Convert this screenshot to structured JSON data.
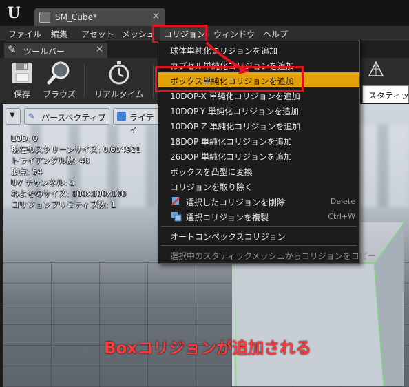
{
  "window": {
    "app_logo": "U",
    "asset_tab": {
      "label": "SM_Cube*",
      "close": "×"
    }
  },
  "menubar": {
    "items": [
      "ファイル",
      "編集",
      "アセット",
      "メッシュ",
      "コリジョン",
      "ウィンドウ",
      "ヘルプ"
    ],
    "active": "コリジョン"
  },
  "toolbar": {
    "tab_label": "ツールバー",
    "tab_close": "×",
    "buttons": [
      "保存",
      "ブラウズ",
      "リアルタイム"
    ]
  },
  "viewport": {
    "menu_arrow": "▼",
    "perspective_label": "パースペクティブ",
    "lit_label": "ライティ",
    "stats": [
      "LOD: 0",
      "現在のスクリーンサイズ: 0.604921",
      "トライアングル数: 48",
      "頂点: 54",
      "UV チャンネル: 3",
      "およそのサイズ: 100x100x100",
      "コリジョンプリミティブ数: 1"
    ]
  },
  "tooltip": {
    "label": "スタティック"
  },
  "collision_menu": {
    "items": [
      {
        "label": "球体単純化コリジョンを追加",
        "shortcut": ""
      },
      {
        "label": "カプセル単純化コリジョンを追加",
        "shortcut": ""
      },
      {
        "label": "ボックス単純化コリジョンを追加",
        "shortcut": ""
      },
      {
        "label": "10DOP-X 単純化コリジョンを追加",
        "shortcut": ""
      },
      {
        "label": "10DOP-Y 単純化コリジョンを追加",
        "shortcut": ""
      },
      {
        "label": "10DOP-Z 単純化コリジョンを追加",
        "shortcut": ""
      },
      {
        "label": "18DOP 単純化コリジョンを追加",
        "shortcut": ""
      },
      {
        "label": "26DOP 単純化コリジョンを追加",
        "shortcut": ""
      },
      {
        "label": "ボックスを凸型に変換",
        "shortcut": ""
      },
      {
        "label": "コリジョンを取り除く",
        "shortcut": ""
      },
      {
        "label": "選択したコリジョンを削除",
        "shortcut": "Delete"
      },
      {
        "label": "選択コリジョンを複製",
        "shortcut": "Ctrl+W"
      },
      {
        "label": "オートコンベックスコリジョン",
        "shortcut": ""
      },
      {
        "label": "選択中のスタティックメッシュからコリジョンをコピー",
        "shortcut": ""
      }
    ],
    "highlighted": "ボックス単純化コリジョンを追加"
  },
  "annotation": {
    "caption": "Boxコリジョンが追加される",
    "color": "#e0141e"
  },
  "colors": {
    "highlight": "#e3a10a",
    "collision_wire": "#7fe07a"
  }
}
